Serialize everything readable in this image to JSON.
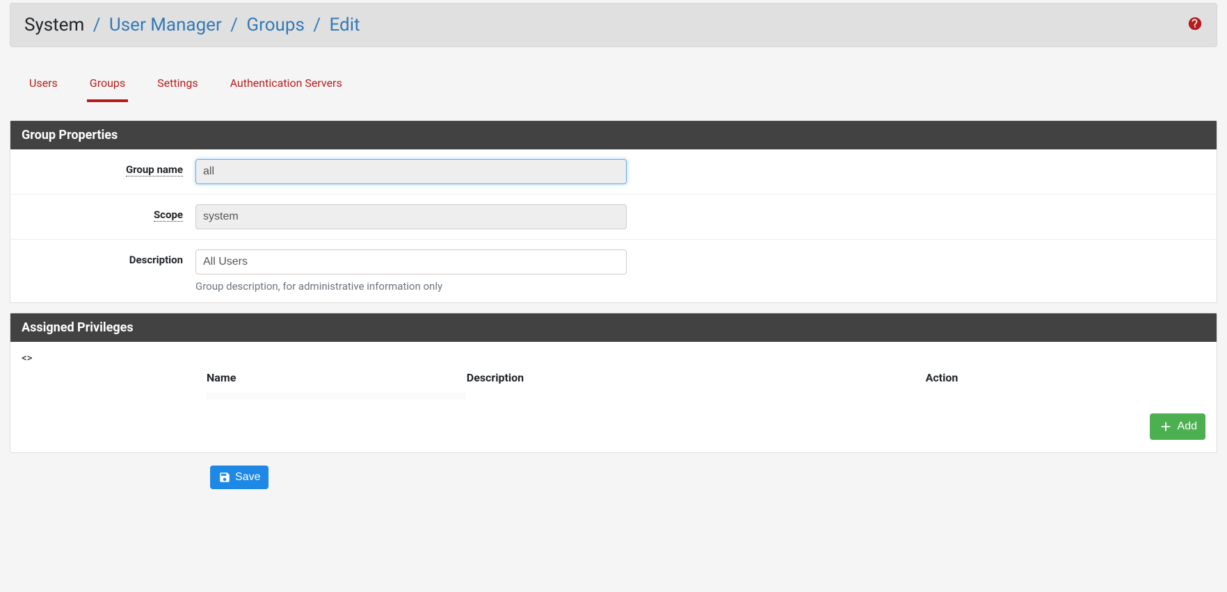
{
  "breadcrumb": {
    "root": "System",
    "part1": "User Manager",
    "part2": "Groups",
    "part3": "Edit"
  },
  "tabs": {
    "users": "Users",
    "groups": "Groups",
    "settings": "Settings",
    "auth_servers": "Authentication Servers",
    "active": "groups"
  },
  "panels": {
    "properties_title": "Group Properties",
    "privileges_title": "Assigned Privileges"
  },
  "form": {
    "group_name": {
      "label": "Group name",
      "value": "all"
    },
    "scope": {
      "label": "Scope",
      "value": "system"
    },
    "description": {
      "label": "Description",
      "value": "All Users",
      "help": "Group description, for administrative information only"
    }
  },
  "priv_table": {
    "columns": {
      "name": "Name",
      "description": "Description",
      "action": "Action"
    },
    "rows": []
  },
  "buttons": {
    "add": "Add",
    "save": "Save"
  }
}
